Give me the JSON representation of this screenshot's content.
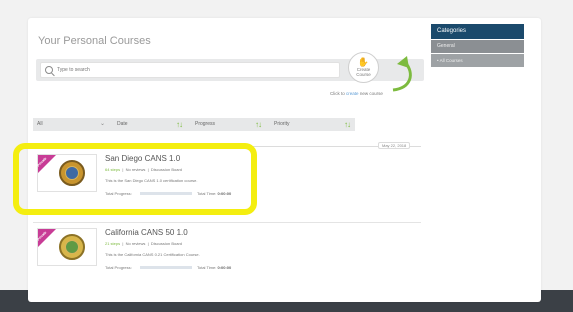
{
  "page": {
    "title": "Your Personal Courses"
  },
  "search": {
    "placeholder": "Type to search",
    "value": ""
  },
  "create_course": {
    "label": "Create Course",
    "hint_prefix": "Click to",
    "hint_link": "create",
    "hint_suffix": "new course"
  },
  "filters": {
    "all": "All",
    "date": "Date",
    "progress": "Progress",
    "priority": "Priority"
  },
  "date_divider": "May 22, 2018",
  "courses": [
    {
      "badge": "Private",
      "title": "San Diego CANS 1.0",
      "steps": "64 steps",
      "reviews": "No reviews",
      "board": "Discussion Board",
      "description": "This is the San Diego CANS 1.0 certification course.",
      "progress_label": "Total Progress:",
      "progress": 0,
      "time_label": "Total Time:",
      "time_value": "0:00:00"
    },
    {
      "badge": "Private",
      "title": "California CANS 50 1.0",
      "steps": "21 steps",
      "reviews": "No reviews",
      "board": "Discussion Board",
      "description": "This is the California CANS 0.21 Certification Course.",
      "progress_label": "Total Progress:",
      "progress": 0,
      "time_label": "Total Time:",
      "time_value": "0:00:00"
    }
  ],
  "sidebar": {
    "header": "Categories",
    "items": [
      {
        "label": "General"
      },
      {
        "label": "All Courses"
      }
    ]
  },
  "colors": {
    "accent_green": "#7dbb3f",
    "header_blue": "#1b4a6c",
    "highlight_yellow": "#f4ee10",
    "private_badge": "#c83c96"
  },
  "icons": [
    "search-icon",
    "plus-icon",
    "curved-arrow-icon",
    "chevron-down-icon",
    "sort-icon",
    "seal-icon"
  ]
}
